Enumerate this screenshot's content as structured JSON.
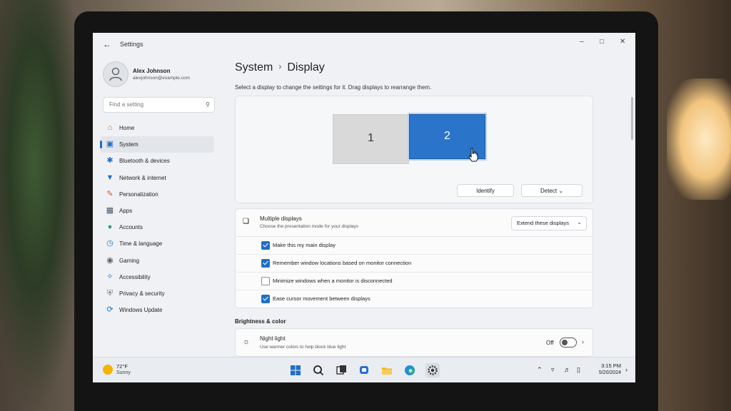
{
  "window": {
    "title": "Settings"
  },
  "profile": {
    "name": "Alex Johnson",
    "email": "alexjohnson@example.com"
  },
  "search": {
    "placeholder": "Find a setting"
  },
  "sidebar": {
    "items": [
      {
        "label": "Home",
        "icon": "home-icon",
        "color": "#c8742e"
      },
      {
        "label": "System",
        "icon": "system-icon",
        "color": "#1f6fc5",
        "active": true
      },
      {
        "label": "Bluetooth & devices",
        "icon": "bluetooth-icon",
        "color": "#1f6fc5"
      },
      {
        "label": "Network & internet",
        "icon": "wifi-icon",
        "color": "#1f6fc5"
      },
      {
        "label": "Personalization",
        "icon": "brush-icon",
        "color": "#d05a2a"
      },
      {
        "label": "Apps",
        "icon": "apps-icon",
        "color": "#4a5766"
      },
      {
        "label": "Accounts",
        "icon": "accounts-icon",
        "color": "#2aa36b"
      },
      {
        "label": "Time & language",
        "icon": "time-language-icon",
        "color": "#1f6fc5"
      },
      {
        "label": "Gaming",
        "icon": "gaming-icon",
        "color": "#5a6470"
      },
      {
        "label": "Accessibility",
        "icon": "accessibility-icon",
        "color": "#1f6fc5"
      },
      {
        "label": "Privacy & security",
        "icon": "shield-icon",
        "color": "#6b7480"
      },
      {
        "label": "Windows Update",
        "icon": "windows-update-icon",
        "color": "#1f6fc5"
      }
    ]
  },
  "breadcrumb": {
    "parent": "System",
    "current": "Display"
  },
  "instruction": "Select a display to change the settings for it. Drag displays to rearrange them.",
  "arrangement": {
    "display1": "1",
    "display2": "2",
    "selected_color": "#2a74c9",
    "identify_label": "Identify",
    "detect_label": "Detect"
  },
  "multiple_displays": {
    "title": "Multiple displays",
    "subtitle": "Choose the presentation mode for your displays",
    "mode": "Extend these displays",
    "options": [
      {
        "label": "Make this my main display",
        "checked": true
      },
      {
        "label": "Remember window locations based on monitor connection",
        "checked": true
      },
      {
        "label": "Minimize windows when a monitor is disconnected",
        "checked": false
      },
      {
        "label": "Ease cursor movement between displays",
        "checked": true
      }
    ]
  },
  "brightness": {
    "section_title": "Brightness & color",
    "night_light_title": "Night light",
    "night_light_sub": "Use warmer colors to help block blue light",
    "night_light_state": "Off"
  },
  "taskbar": {
    "weather_temp": "72°F",
    "weather_desc": "Sunny",
    "time": "3:15 PM",
    "date": "5/20/2024",
    "accent": "#1f6fc5"
  }
}
